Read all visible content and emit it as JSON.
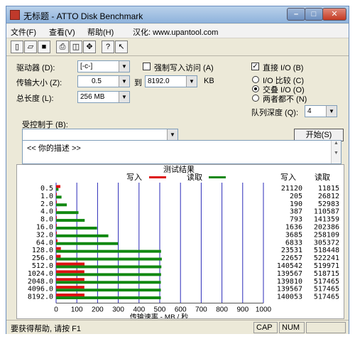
{
  "window": {
    "title": "无标题 - ATTO Disk Benchmark"
  },
  "menu": {
    "file": "文件(F)",
    "view": "查看(V)",
    "help": "帮助(H)",
    "localized": "汉化: www.upantool.com"
  },
  "toolbar": {
    "icons": [
      "new-icon",
      "open-icon",
      "save-icon",
      "print-icon",
      "print-preview-icon",
      "move-icon",
      "help-icon",
      "context-help-icon"
    ]
  },
  "form": {
    "drive_label": "驱动器 (D):",
    "drive_value": "[-c-]",
    "force_write_label": "强制写入访问 (A)",
    "direct_io_label": "直接 I/O (B)",
    "transfer_label": "传输大小 (Z):",
    "transfer_from": "0.5",
    "to_label": "到",
    "transfer_to": "8192.0",
    "kb_label": "KB",
    "total_label": "总长度 (L):",
    "total_value": "256 MB",
    "io_compare_label": "I/O 比较 (C)",
    "overlap_label": "交叠 I/O (O)",
    "neither_label": "两者都不 (N)",
    "queue_label": "队列深度 (Q):",
    "queue_value": "4",
    "controlled_label": "受控制于 (B):",
    "controlled_value": "",
    "start_label": "开始(S)",
    "description": "<< 你的描述 >>"
  },
  "chart_data": {
    "type": "bar",
    "title": "测试结果",
    "write_legend": "写入",
    "read_legend": "读取",
    "write_col_header": "写入",
    "read_col_header": "读取",
    "xlabel": "传输速率 - MB / 秒",
    "xlim": [
      0,
      1000
    ],
    "xticks": [
      "0",
      "100",
      "200",
      "300",
      "400",
      "500",
      "600",
      "700",
      "800",
      "900",
      "1000"
    ],
    "categories": [
      "0.5",
      "1.0",
      "2.0",
      "4.0",
      "8.0",
      "16.0",
      "32.0",
      "64.0",
      "128.0",
      "256.0",
      "512.0",
      "1024.0",
      "2048.0",
      "4096.0",
      "8192.0"
    ],
    "series": [
      {
        "name": "写入",
        "color": "#dd1111",
        "values": [
          20.6,
          0.2,
          0.19,
          0.38,
          0.77,
          1.6,
          3.6,
          6.7,
          23.0,
          22.1,
          137.2,
          136.3,
          136.5,
          136.3,
          136.8
        ],
        "labels": [
          "21120",
          "205",
          "190",
          "387",
          "793",
          "1636",
          "3685",
          "6833",
          "23531",
          "22657",
          "140542",
          "139567",
          "139810",
          "139567",
          "140053"
        ]
      },
      {
        "name": "读取",
        "color": "#118811",
        "values": [
          11.5,
          26.2,
          51.7,
          108.0,
          138.0,
          197.5,
          252.1,
          298.4,
          506.3,
          510.0,
          507.8,
          506.4,
          505.3,
          505.3,
          505.3
        ],
        "labels": [
          "11815",
          "26812",
          "52983",
          "110587",
          "141359",
          "202386",
          "258109",
          "305372",
          "518448",
          "522241",
          "519971",
          "518715",
          "517465",
          "517465",
          "517465"
        ]
      }
    ]
  },
  "status": {
    "help_text": "要获得帮助, 请按 F1",
    "cap": "CAP",
    "num": "NUM"
  },
  "colors": {
    "grid": "#2a2ab8"
  }
}
